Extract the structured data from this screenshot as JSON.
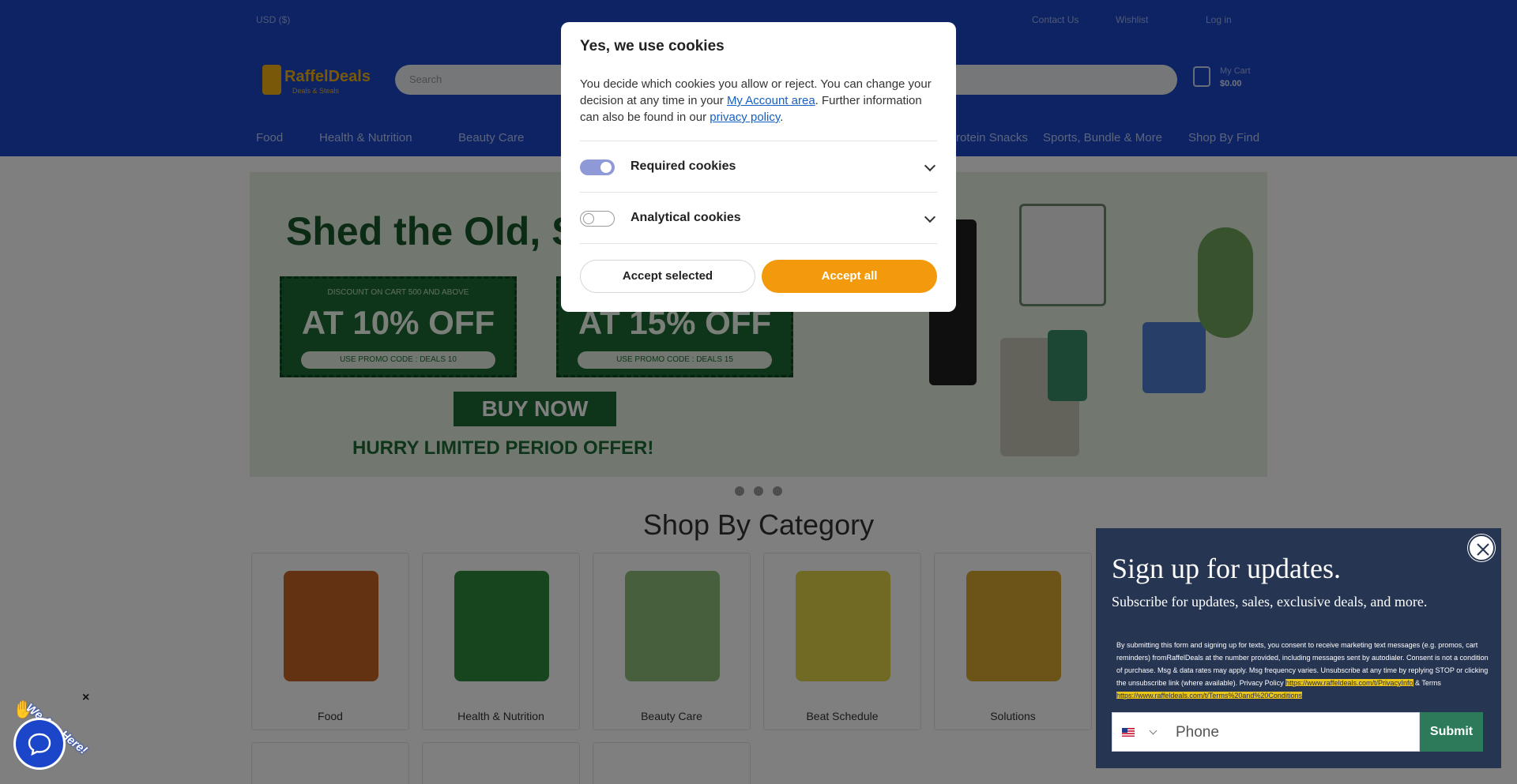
{
  "header": {
    "topbar": {
      "left": "USD ($)",
      "right1": "Contact Us",
      "right2": "Wishlist",
      "right3": "Log in"
    },
    "logo": {
      "name": "RaffelDeals",
      "tagline": "Deals & Steals"
    },
    "search_placeholder": "Search",
    "cart": {
      "label": "My Cart",
      "value": "$0.00"
    },
    "nav": [
      "Food",
      "Health & Nutrition",
      "Beauty Care",
      "Protein Snacks",
      "Sports, Bundle & More",
      "Shop By Find"
    ]
  },
  "hero": {
    "headline": "Shed the Old, S",
    "badge1": {
      "small": "DISCOUNT ON CART 500 AND ABOVE",
      "big": "AT 10% OFF",
      "code": "USE PROMO CODE : DEALS 10"
    },
    "badge2": {
      "small": "",
      "big": "AT 15% OFF",
      "code": "USE PROMO CODE : DEALS 15"
    },
    "buy_now": "BUY NOW",
    "hurry": "HURRY LIMITED PERIOD OFFER!"
  },
  "category": {
    "title": "Shop By Category",
    "items": [
      {
        "label": "Food",
        "color": "#c46424"
      },
      {
        "label": "Health & Nutrition",
        "color": "#2f8a3c"
      },
      {
        "label": "Beauty Care",
        "color": "#8fbf7a"
      },
      {
        "label": "Beat Schedule",
        "color": "#e1d44a"
      },
      {
        "label": "Solutions",
        "color": "#d9a832"
      }
    ]
  },
  "cookie": {
    "title": "Yes, we use cookies",
    "desc_before": "You decide which cookies you allow or reject. You can change your decision at any time in your ",
    "link1": "My Account area",
    "desc_middle": ". Further information can also be found in our ",
    "link2": "privacy policy",
    "desc_after": ".",
    "required": "Required cookies",
    "analytical": "Analytical cookies",
    "accept_selected": "Accept selected",
    "accept_all": "Accept all"
  },
  "signup": {
    "title": "Sign up for updates.",
    "subtitle": "Subscribe for updates, sales, exclusive deals, and more.",
    "fine_before": "By submitting this form and signing up for texts, you consent to receive marketing text messages (e.g. promos, cart reminders) fromRaffelDeals   at the number provided, including messages sent by autodialer. Consent is not a condition of purchase. Msg & data rates may apply. Msg frequency varies. Unsubscribe at any time by replying STOP or clicking the unsubscribe link (where available). Privacy Policy ",
    "privacy_link": "https://www.raffeldeals.com/t/PrivacyInfo",
    "fine_middle": " & Terms ",
    "terms_link": "https://www.raffeldeals.com/t/Terms%20and%20Conditions",
    "phone_placeholder": "Phone",
    "submit": "Submit"
  },
  "chat": {
    "label": "We Are Here!",
    "close": "×"
  }
}
